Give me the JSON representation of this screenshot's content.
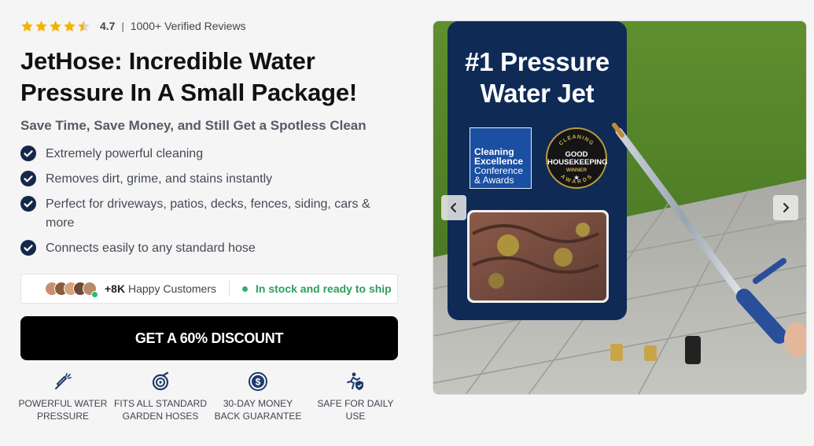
{
  "rating": {
    "value": "4.7",
    "stars": 4.5,
    "separator": "|",
    "reviews": "1000+ Verified Reviews",
    "star_color": "#f5b301"
  },
  "product": {
    "title": "JetHose: Incredible Water Pressure In A Small Package!",
    "subtitle": "Save Time, Save Money, and Still Get a Spotless Clean"
  },
  "benefits": [
    "Extremely powerful cleaning",
    "Removes dirt, grime, and stains instantly",
    "Perfect for driveways, patios, decks, fences, siding, cars & more",
    "Connects easily to any standard hose"
  ],
  "trust": {
    "customers_count": "+8K",
    "customers_label": "Happy Customers",
    "stock": "In stock and ready to ship",
    "stock_color": "#2fb26a"
  },
  "cta": {
    "label": "GET A 60% DISCOUNT",
    "background": "#000000"
  },
  "features": [
    {
      "icon": "pressure-wand-icon",
      "label": "POWERFUL WATER PRESSURE"
    },
    {
      "icon": "hose-reel-icon",
      "label": "FITS ALL STANDARD GARDEN HOSES"
    },
    {
      "icon": "money-back-icon",
      "label": "30-DAY MONEY BACK GUARANTEE"
    },
    {
      "icon": "safe-shield-icon",
      "label": "SAFE FOR DAILY USE"
    }
  ],
  "gallery": {
    "heading": "#1 Pressure Water Jet",
    "award_1": {
      "line1": "Cleaning",
      "line2": "Excellence",
      "line3": "Conference",
      "line4": "& Awards"
    },
    "award_2": {
      "ring_top": "CLEANING",
      "line1": "GOOD",
      "line2": "HOUSEKEEPING",
      "line3": "WINNER",
      "line4": "★",
      "ring_bottom": "AWARDS"
    },
    "prev_icon": "chevron-left-icon",
    "next_icon": "chevron-right-icon",
    "panel_color": "#0f2a55"
  }
}
